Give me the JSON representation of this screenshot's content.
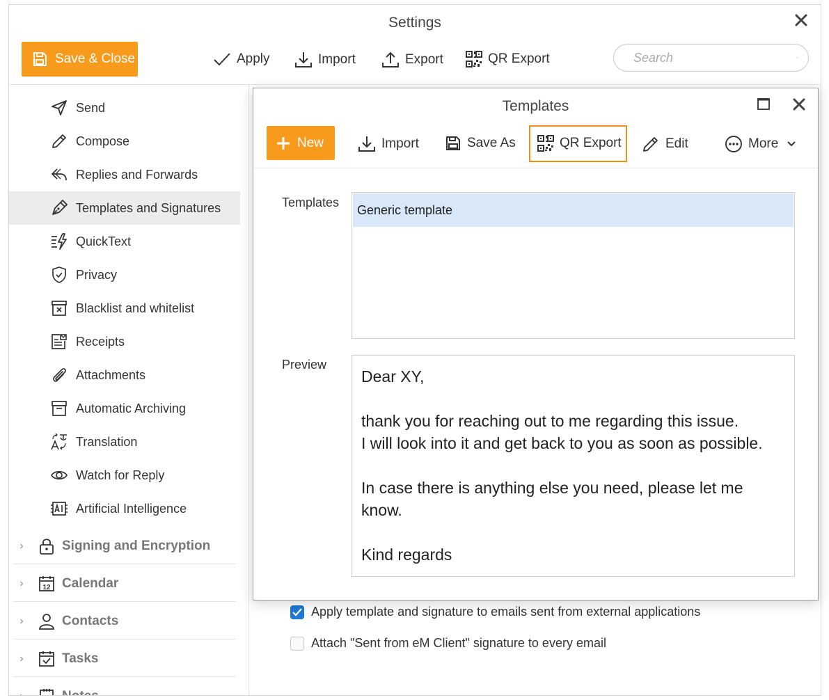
{
  "window": {
    "title": "Settings",
    "toolbar": {
      "save_close": "Save & Close",
      "apply": "Apply",
      "import": "Import",
      "export": "Export",
      "qr_export": "QR Export"
    },
    "search": {
      "placeholder": "Search"
    }
  },
  "sidebar": {
    "items": [
      {
        "label": "Send",
        "icon": "send-icon"
      },
      {
        "label": "Compose",
        "icon": "pencil-icon"
      },
      {
        "label": "Replies and Forwards",
        "icon": "reply-icon"
      },
      {
        "label": "Templates and Signatures",
        "icon": "pen-nib-icon",
        "active": true
      },
      {
        "label": "QuickText",
        "icon": "quicktext-icon"
      },
      {
        "label": "Privacy",
        "icon": "shield-icon"
      },
      {
        "label": "Blacklist and whitelist",
        "icon": "blacklist-icon"
      },
      {
        "label": "Receipts",
        "icon": "receipt-icon"
      },
      {
        "label": "Attachments",
        "icon": "paperclip-icon"
      },
      {
        "label": "Automatic Archiving",
        "icon": "archive-icon"
      },
      {
        "label": "Translation",
        "icon": "translate-icon"
      },
      {
        "label": "Watch for Reply",
        "icon": "eye-icon"
      },
      {
        "label": "Artificial Intelligence",
        "icon": "ai-icon"
      }
    ],
    "groups": [
      {
        "label": "Signing and Encryption",
        "icon": "lock-icon"
      },
      {
        "label": "Calendar",
        "icon": "calendar-icon"
      },
      {
        "label": "Contacts",
        "icon": "person-icon"
      },
      {
        "label": "Tasks",
        "icon": "task-icon"
      },
      {
        "label": "Notes",
        "icon": "notes-icon"
      }
    ]
  },
  "options": {
    "apply_external": {
      "label": "Apply template and signature to emails sent from external applications",
      "checked": true
    },
    "sent_from": {
      "label": "Attach \"Sent from eM Client\" signature to every email",
      "checked": false
    }
  },
  "dialog": {
    "title": "Templates",
    "toolbar": {
      "new": "New",
      "import": "Import",
      "save_as": "Save As",
      "qr_export": "QR Export",
      "edit": "Edit",
      "more": "More"
    },
    "templates_label": "Templates",
    "templates": [
      "Generic template"
    ],
    "preview_label": "Preview",
    "preview": {
      "greeting": "Dear XY,",
      "line1": "thank you for reaching out to me regarding this issue.",
      "line2": "I will look into it and get back to you as soon as possible.",
      "line3": "In case there is anything else you need, please let me know.",
      "closing": "Kind regards"
    }
  },
  "colors": {
    "accent": "#f89a1c",
    "selection": "#d9e8f8",
    "checkbox": "#1f78d1"
  }
}
